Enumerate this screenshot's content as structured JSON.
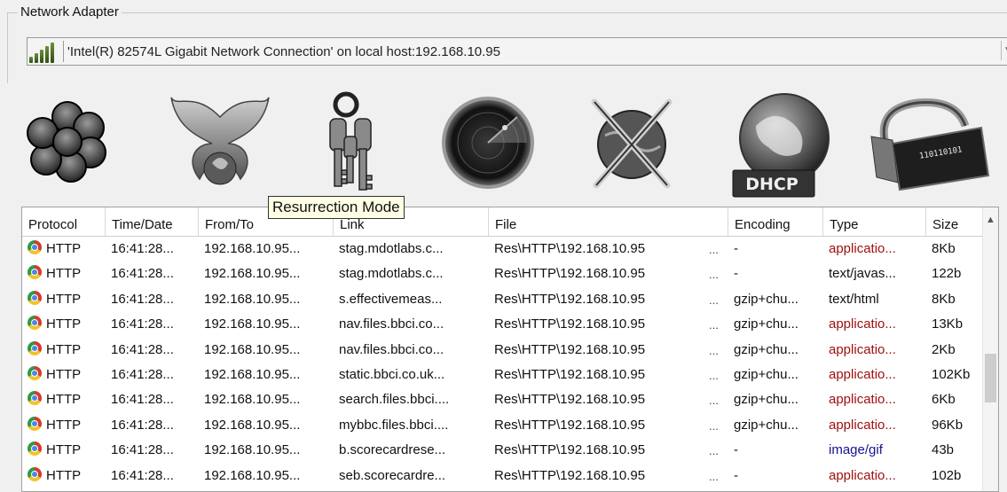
{
  "adapter": {
    "group_title": "Network Adapter",
    "selected": "'Intel(R) 82574L Gigabit Network Connection' on local host:192.168.10.95",
    "signal_icon": "signal-bars-icon"
  },
  "toolbar": {
    "buttons": [
      {
        "icon": "flower-icon"
      },
      {
        "icon": "phoenix-icon"
      },
      {
        "icon": "keys-icon"
      },
      {
        "icon": "radar-icon"
      },
      {
        "icon": "globe-tools-icon"
      },
      {
        "icon": "dhcp-globe-icon",
        "badge": "DHCP"
      },
      {
        "icon": "network-card-icon",
        "digits": "110110101"
      }
    ],
    "tooltip": "Resurrection Mode"
  },
  "table": {
    "columns": [
      "Protocol",
      "Time/Date",
      "From/To",
      "Link",
      "File",
      "Encoding",
      "Type",
      "Size"
    ],
    "rows": [
      {
        "protocol": "HTTP",
        "time": "16:41:28...",
        "from": "192.168.10.95...",
        "link": "stag.mdotlabs.c...",
        "file": "Res\\HTTP\\192.168.10.95",
        "more": "...",
        "encoding": "-",
        "type": "applicatio...",
        "size": "8Kb"
      },
      {
        "protocol": "HTTP",
        "time": "16:41:28...",
        "from": "192.168.10.95...",
        "link": "stag.mdotlabs.c...",
        "file": "Res\\HTTP\\192.168.10.95",
        "more": "...",
        "encoding": "-",
        "type": "text/javas...",
        "size": "122b"
      },
      {
        "protocol": "HTTP",
        "time": "16:41:28...",
        "from": "192.168.10.95...",
        "link": "s.effectivemeas...",
        "file": "Res\\HTTP\\192.168.10.95",
        "more": "...",
        "encoding": "gzip+chu...",
        "type": "text/html",
        "size": "8Kb"
      },
      {
        "protocol": "HTTP",
        "time": "16:41:28...",
        "from": "192.168.10.95...",
        "link": "nav.files.bbci.co...",
        "file": "Res\\HTTP\\192.168.10.95",
        "more": "...",
        "encoding": "gzip+chu...",
        "type": "applicatio...",
        "size": "13Kb"
      },
      {
        "protocol": "HTTP",
        "time": "16:41:28...",
        "from": "192.168.10.95...",
        "link": "nav.files.bbci.co...",
        "file": "Res\\HTTP\\192.168.10.95",
        "more": "...",
        "encoding": "gzip+chu...",
        "type": "applicatio...",
        "size": "2Kb"
      },
      {
        "protocol": "HTTP",
        "time": "16:41:28...",
        "from": "192.168.10.95...",
        "link": "static.bbci.co.uk...",
        "file": "Res\\HTTP\\192.168.10.95",
        "more": "...",
        "encoding": "gzip+chu...",
        "type": "applicatio...",
        "size": "102Kb"
      },
      {
        "protocol": "HTTP",
        "time": "16:41:28...",
        "from": "192.168.10.95...",
        "link": "search.files.bbci....",
        "file": "Res\\HTTP\\192.168.10.95",
        "more": "...",
        "encoding": "gzip+chu...",
        "type": "applicatio...",
        "size": "6Kb"
      },
      {
        "protocol": "HTTP",
        "time": "16:41:28...",
        "from": "192.168.10.95...",
        "link": "mybbc.files.bbci....",
        "file": "Res\\HTTP\\192.168.10.95",
        "more": "...",
        "encoding": "gzip+chu...",
        "type": "applicatio...",
        "size": "96Kb"
      },
      {
        "protocol": "HTTP",
        "time": "16:41:28...",
        "from": "192.168.10.95...",
        "link": "b.scorecardrese...",
        "file": "Res\\HTTP\\192.168.10.95",
        "more": "...",
        "encoding": "-",
        "type": "image/gif",
        "size": "43b"
      },
      {
        "protocol": "HTTP",
        "time": "16:41:28...",
        "from": "192.168.10.95...",
        "link": "seb.scorecardre...",
        "file": "Res\\HTTP\\192.168.10.95",
        "more": "...",
        "encoding": "-",
        "type": "applicatio...",
        "size": "102b"
      }
    ]
  },
  "colors": {
    "type_application": "#a01010",
    "type_image": "#14148c",
    "type_text": "#111111"
  }
}
